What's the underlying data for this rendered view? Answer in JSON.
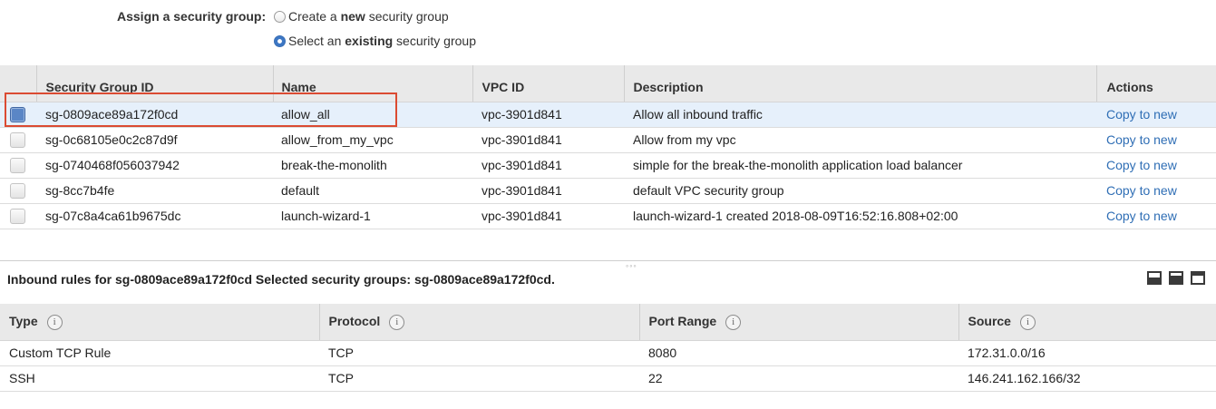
{
  "assign": {
    "label": "Assign a security group:",
    "options": [
      {
        "pre": "Create a ",
        "bold": "new",
        "post": " security group",
        "selected": false
      },
      {
        "pre": "Select an ",
        "bold": "existing",
        "post": " security group",
        "selected": true
      }
    ]
  },
  "sg_table": {
    "headers": {
      "id": "Security Group ID",
      "name": "Name",
      "vpc": "VPC ID",
      "desc": "Description",
      "actions": "Actions"
    },
    "rows": [
      {
        "checked": true,
        "id": "sg-0809ace89a172f0cd",
        "name": "allow_all",
        "vpc": "vpc-3901d841",
        "desc": "Allow all inbound traffic",
        "action": "Copy to new"
      },
      {
        "checked": false,
        "id": "sg-0c68105e0c2c87d9f",
        "name": "allow_from_my_vpc",
        "vpc": "vpc-3901d841",
        "desc": "Allow from my vpc",
        "action": "Copy to new"
      },
      {
        "checked": false,
        "id": "sg-0740468f056037942",
        "name": "break-the-monolith",
        "vpc": "vpc-3901d841",
        "desc": "simple for the break-the-monolith application load balancer",
        "action": "Copy to new"
      },
      {
        "checked": false,
        "id": "sg-8cc7b4fe",
        "name": "default",
        "vpc": "vpc-3901d841",
        "desc": "default VPC security group",
        "action": "Copy to new"
      },
      {
        "checked": false,
        "id": "sg-07c8a4ca61b9675dc",
        "name": "launch-wizard-1",
        "vpc": "vpc-3901d841",
        "desc": "launch-wizard-1 created 2018-08-09T16:52:16.808+02:00",
        "action": "Copy to new"
      }
    ]
  },
  "splitter": {
    "grip": "◦◦◦"
  },
  "inbound": {
    "title": "Inbound rules for sg-0809ace89a172f0cd Selected security groups: sg-0809ace89a172f0cd.",
    "info_glyph": "i",
    "headers": {
      "type": "Type",
      "protocol": "Protocol",
      "port": "Port Range",
      "source": "Source"
    },
    "rows": [
      {
        "type": "Custom TCP Rule",
        "protocol": "TCP",
        "port": "8080",
        "source": "172.31.0.0/16"
      },
      {
        "type": "SSH",
        "protocol": "TCP",
        "port": "22",
        "source": "146.241.162.166/32"
      }
    ]
  },
  "colors": {
    "accent": "#2f6eb5",
    "selected_row": "#e6f0fb",
    "highlight": "#db4b32"
  }
}
